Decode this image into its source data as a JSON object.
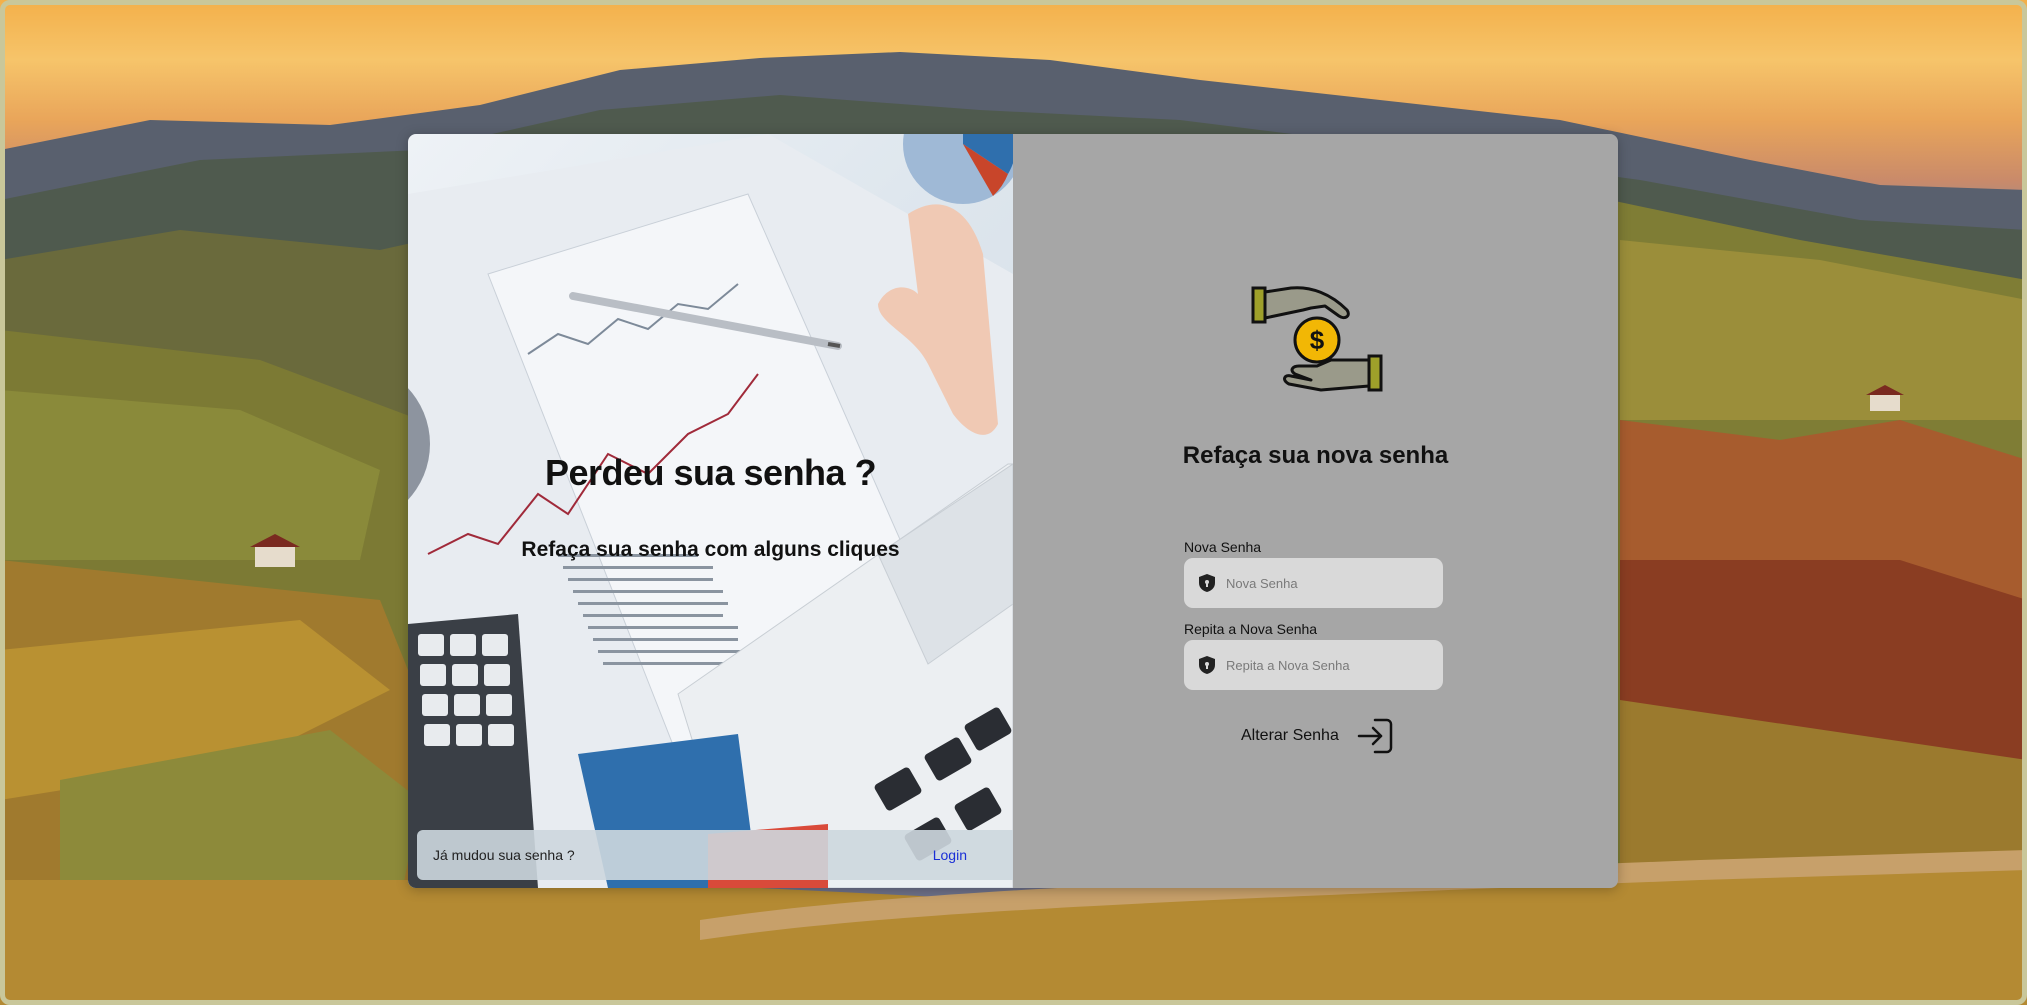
{
  "left": {
    "title": "Perdeu sua senha ?",
    "subtitle": "Refaça sua senha com alguns cliques",
    "footer_question": "Já mudou sua senha ?",
    "footer_link": "Login"
  },
  "right": {
    "title": "Refaça sua nova senha",
    "logo_icon": "hand-coin-icon",
    "fields": [
      {
        "label": "Nova Senha",
        "placeholder": "Nova Senha",
        "value": "",
        "icon": "shield-icon"
      },
      {
        "label": "Repita a Nova Senha",
        "placeholder": "Repita a Nova Senha",
        "value": "",
        "icon": "shield-icon"
      }
    ],
    "submit_label": "Alterar Senha",
    "submit_icon": "sign-in-icon"
  },
  "colors": {
    "right_panel_bg": "#a6a6a6",
    "input_bg": "#d9d9d9",
    "link": "#1a2fd6",
    "logo_accent": "#f2b705",
    "logo_olive": "#9ea02a"
  }
}
